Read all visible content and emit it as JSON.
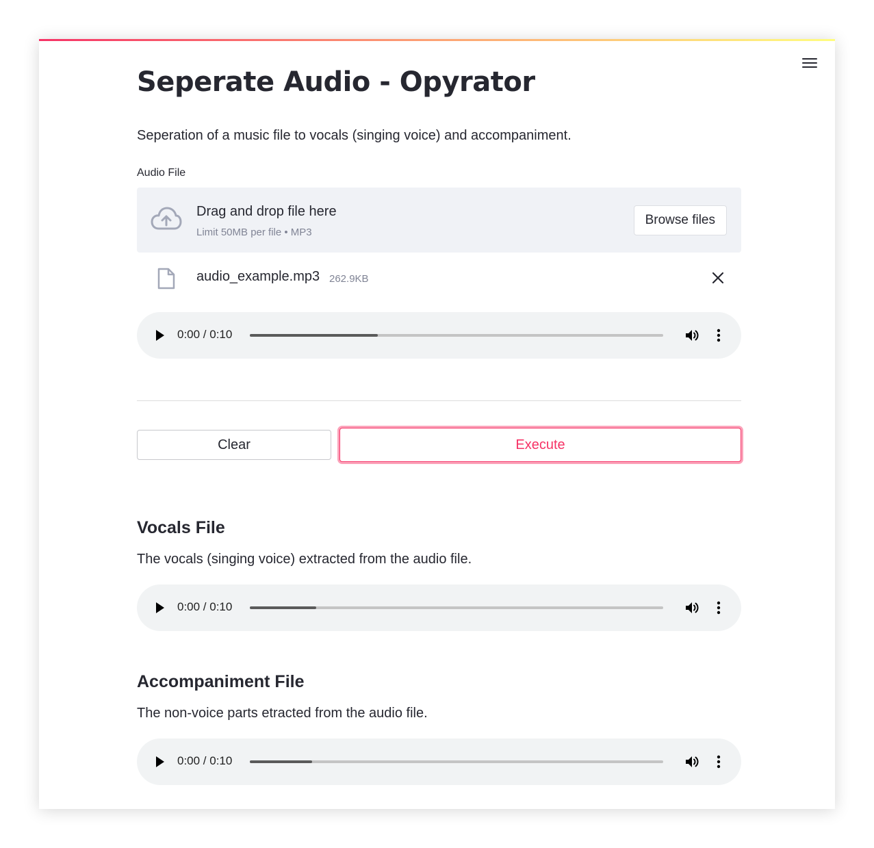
{
  "app": {
    "title": "Seperate Audio - Opyrator",
    "description": "Seperation of a music file to vocals (singing voice) and accompaniment."
  },
  "input": {
    "label": "Audio File",
    "dropzone": {
      "title": "Drag and drop file here",
      "limit": "Limit 50MB per file • MP3",
      "browse_label": "Browse files"
    },
    "file": {
      "name": "audio_example.mp3",
      "size": "262.9KB"
    },
    "player": {
      "time": "0:00 / 0:10",
      "progress": 0.31
    }
  },
  "buttons": {
    "clear": "Clear",
    "execute": "Execute"
  },
  "outputs": {
    "vocals": {
      "title": "Vocals File",
      "description": "The vocals (singing voice) extracted from the audio file.",
      "player": {
        "time": "0:00 / 0:10",
        "progress": 0.16
      }
    },
    "accompaniment": {
      "title": "Accompaniment File",
      "description": "The non-voice parts etracted from the audio file.",
      "player": {
        "time": "0:00 / 0:10",
        "progress": 0.15
      }
    }
  },
  "icons": {
    "menu": "hamburger-menu-icon",
    "upload": "cloud-upload-icon",
    "file": "file-icon",
    "remove": "close-icon",
    "play": "play-icon",
    "volume": "volume-icon",
    "more": "more-vertical-icon"
  },
  "colors": {
    "accent": "#f63366",
    "dropzone_bg": "#f0f2f6",
    "player_bg": "#f1f3f4",
    "text": "#262730",
    "muted": "#808495"
  }
}
